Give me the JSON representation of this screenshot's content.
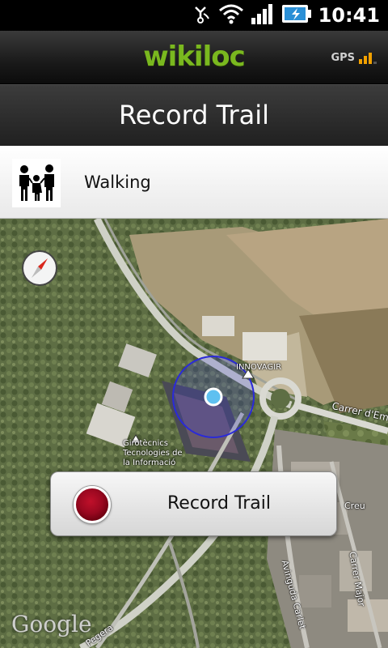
{
  "status_bar": {
    "time": "10:41",
    "icons": [
      "usb-debug-icon",
      "wifi-icon",
      "signal-icon",
      "battery-charging-icon"
    ]
  },
  "app_header": {
    "logo_text": "wikiloc",
    "gps_label": "GPS",
    "gps_signal_bars": 3
  },
  "title_bar": {
    "title": "Record Trail"
  },
  "activity": {
    "icon": "family-walking-icon",
    "label": "Walking"
  },
  "map": {
    "labels": {
      "innovagir": "INNOVAGIR",
      "carrer_emil": "Carrer d'Emil",
      "girotecnics_1": "Girotècnics",
      "girotecnics_2": "Tecnologies de",
      "girotecnics_3": "la Informació",
      "creu": "Creu",
      "avinguda": "Avinguda Carlet",
      "carrer_major": "Carrer Major",
      "pegera": "Pegera"
    },
    "attribution": "Google"
  },
  "record_button": {
    "label": "Record Trail"
  },
  "colors": {
    "logo_green": "#7ab81f",
    "gps_orange": "#f2a100",
    "accuracy_circle": "#2a2ad8",
    "record_red": "#9a0820"
  }
}
